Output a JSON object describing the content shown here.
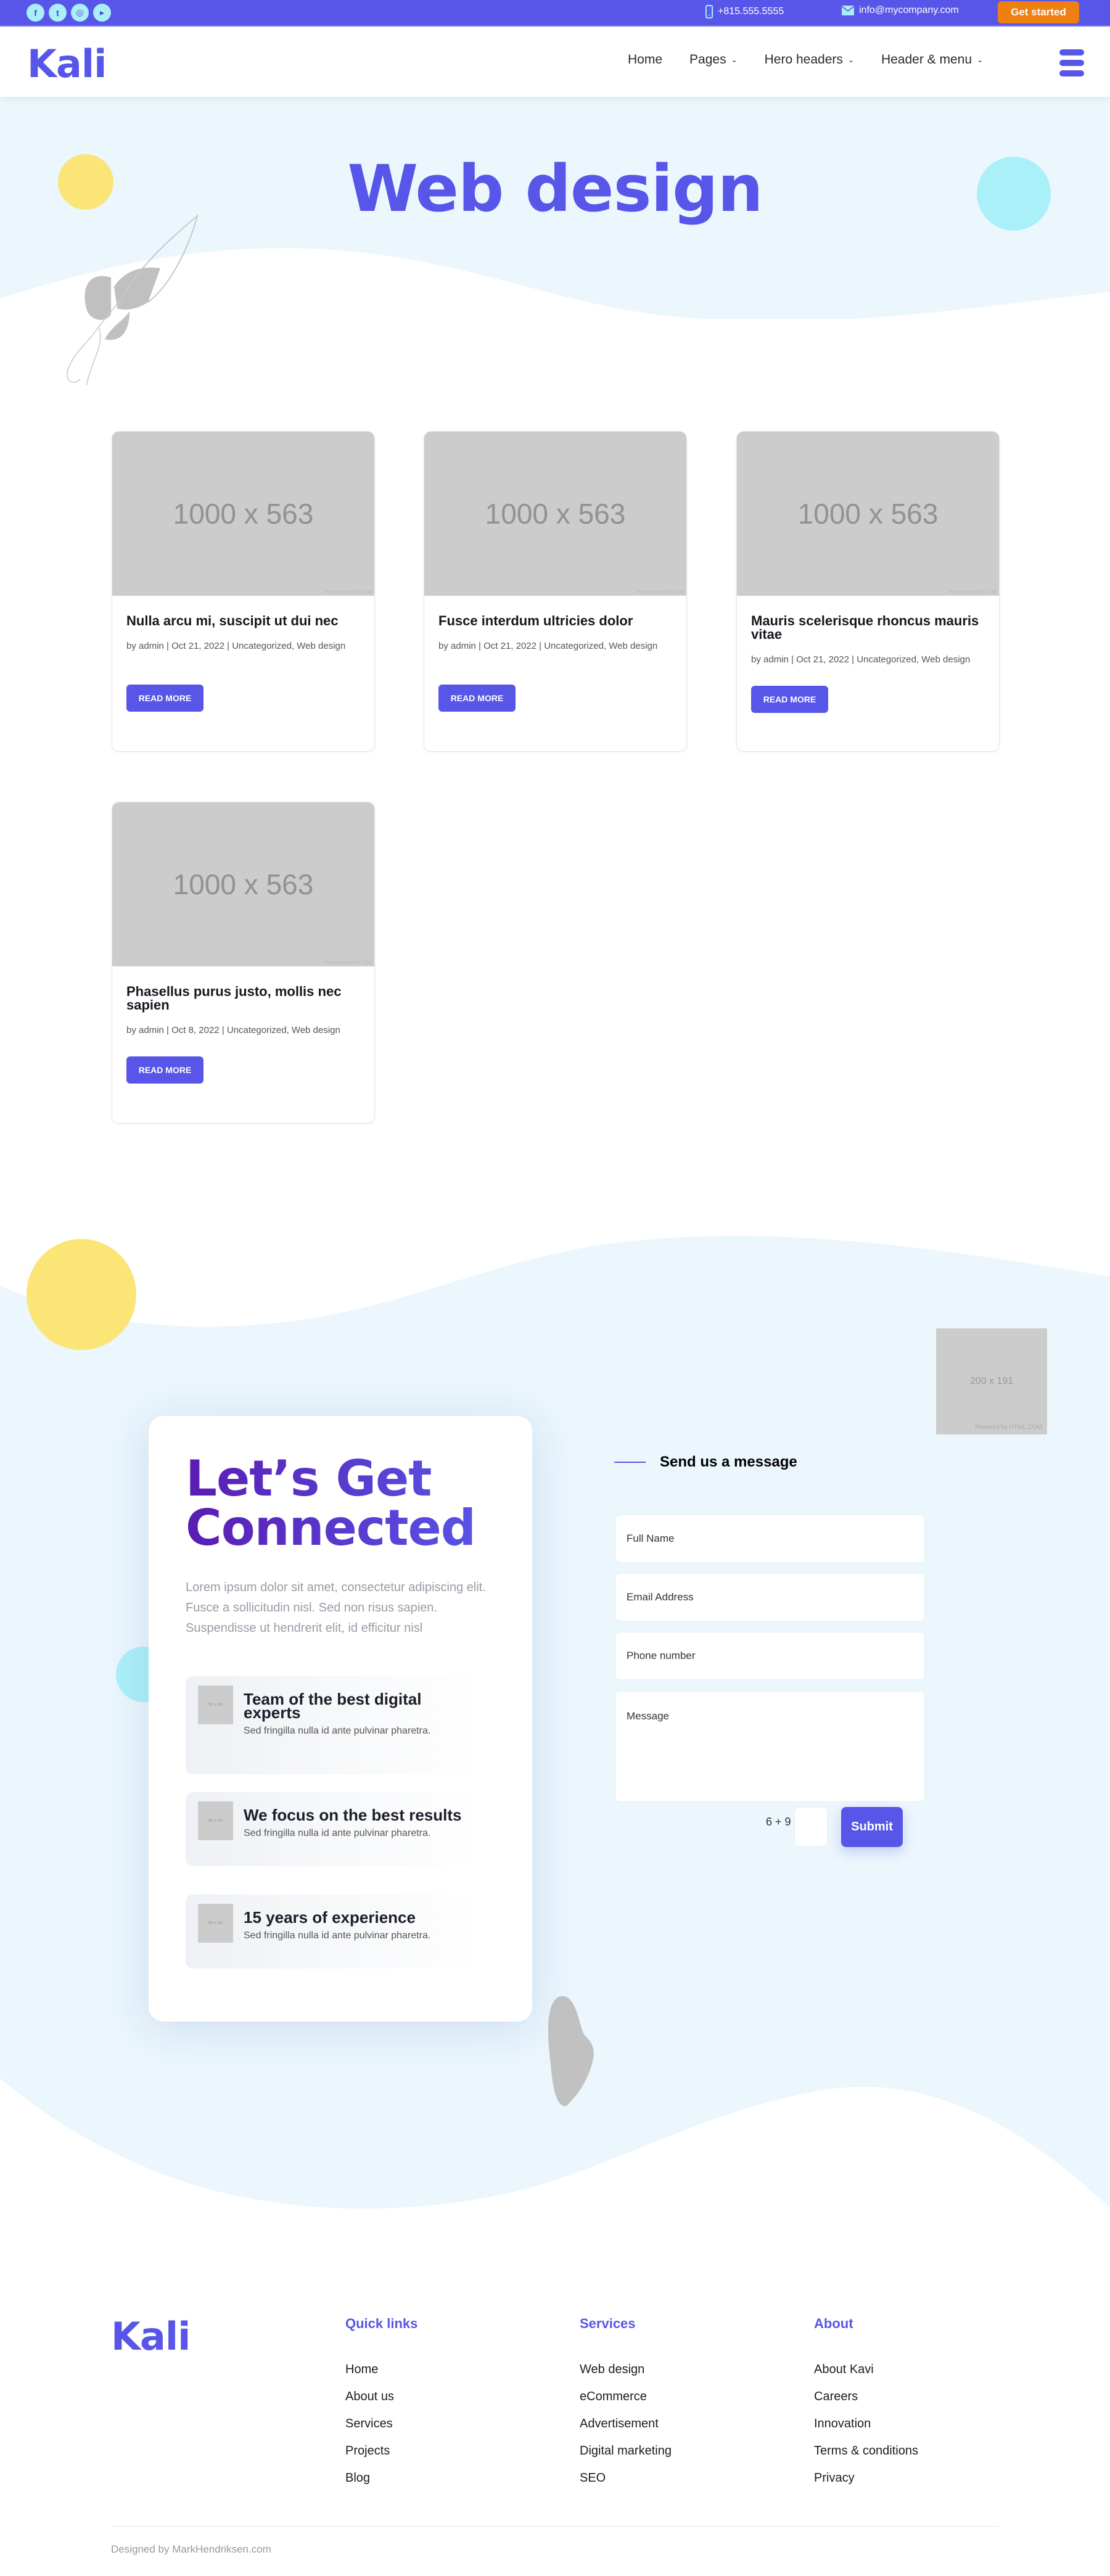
{
  "topbar": {
    "socials": [
      {
        "icon": "facebook-icon",
        "glyph": "f"
      },
      {
        "icon": "twitter-icon",
        "glyph": "t"
      },
      {
        "icon": "instagram-icon",
        "glyph": "◎"
      },
      {
        "icon": "youtube-icon",
        "glyph": "▸"
      }
    ],
    "phone": "+815.555.5555",
    "email": "info@mycompany.com",
    "cta": "Get started",
    "colors": {
      "bar": "#5856e8",
      "cta": "#ee7f11",
      "social": "#a9eef9"
    }
  },
  "nav": {
    "logo": "Kali",
    "items": [
      {
        "label": "Home",
        "has_dropdown": false
      },
      {
        "label": "Pages",
        "has_dropdown": true
      },
      {
        "label": "Hero headers",
        "has_dropdown": true
      },
      {
        "label": "Header & menu",
        "has_dropdown": true
      }
    ]
  },
  "hero": {
    "title": "Web design"
  },
  "posts": [
    {
      "thumb": "1000 x 563",
      "title": "Nulla arcu mi, suscipit ut dui nec",
      "meta": "by admin | Oct 21, 2022 | Uncategorized, Web design",
      "button": "READ MORE"
    },
    {
      "thumb": "1000 x 563",
      "title": "Fusce interdum ultricies dolor",
      "meta": "by admin | Oct 21, 2022 | Uncategorized, Web design",
      "button": "READ MORE"
    },
    {
      "thumb": "1000 x 563",
      "title": "Mauris scelerisque rhoncus mauris vitae",
      "meta": "by admin | Oct 21, 2022 | Uncategorized, Web design",
      "button": "READ MORE"
    },
    {
      "thumb": "1000 x 563",
      "title": "Phasellus purus justo, mollis nec sapien",
      "meta": "by admin | Oct 8, 2022 | Uncategorized, Web design",
      "button": "READ MORE"
    }
  ],
  "thumb_credit": "Powered by HTML.COM",
  "connect": {
    "title_line1": "Let’s Get",
    "title_line2": "Connected",
    "text": "Lorem ipsum dolor sit amet, consectetur adipiscing elit. Fusce a sollicitudin nisl. Sed non risus sapien. Suspendisse ut hendrerit elit, id efficitur nisl",
    "features": [
      {
        "img": "60 x 60",
        "title": "Team of the best digital experts",
        "desc": "Sed fringilla nulla id ante pulvinar pharetra."
      },
      {
        "img": "60 x 60",
        "title": "We focus on the best results",
        "desc": "Sed fringilla nulla id ante pulvinar pharetra."
      },
      {
        "img": "60 x 60",
        "title": "15 years of experience",
        "desc": "Sed fringilla nulla id ante pulvinar pharetra."
      }
    ]
  },
  "form": {
    "heading": "Send us a message",
    "fields": [
      {
        "placeholder": "Full Name"
      },
      {
        "placeholder": "Email Address"
      },
      {
        "placeholder": "Phone number"
      },
      {
        "placeholder": "Message"
      }
    ],
    "captcha": "6 + 9 =",
    "submit": "Submit",
    "side_image": "200 x 191",
    "side_image_credit": "Powered by HTML.COM"
  },
  "footer": {
    "logo": "Kali",
    "columns": [
      {
        "title": "Quick links",
        "links": [
          "Home",
          "About us",
          "Services",
          "Projects",
          "Blog"
        ]
      },
      {
        "title": "Services",
        "links": [
          "Web design",
          "eCommerce",
          "Advertisement",
          "Digital marketing",
          "SEO"
        ]
      },
      {
        "title": "About",
        "links": [
          "About Kavi",
          "Careers",
          "Innovation",
          "Terms & conditions",
          "Privacy"
        ]
      }
    ],
    "credit": "Designed by MarkHendriksen.com"
  }
}
